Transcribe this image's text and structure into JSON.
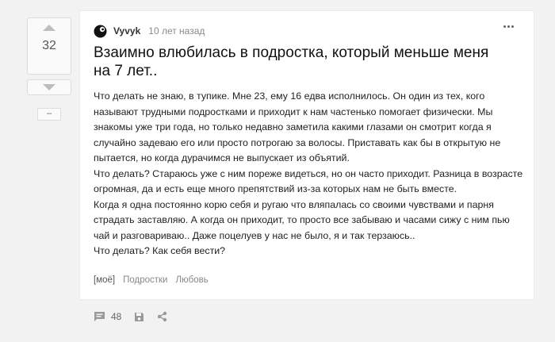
{
  "rating": {
    "count": "32",
    "minus_label": "–"
  },
  "post": {
    "author": "Vyvyk",
    "time": "10 лет назад",
    "title": "Взаимно влюбилась в подростка, который меньше меня на 7 лет..",
    "paragraphs": [
      "Что делать не знаю, в тупике. Мне 23, ему 16 едва исполнилось. Он один из тех, кого называют трудными подростками и приходит к нам частенько помогает физически. Мы знакомы уже три года, но только недавно заметила какими глазами он смотрит когда я случайно задеваю его или просто потрогаю за волосы. Приставать как бы в открытую не пытается, но когда дурачимся не выпускает из объятий.",
      "Что делать? Стараюсь уже с ним пореже видеться, но он часто приходит. Разница в возрасте огромная, да и есть еще много препятствий из-за которых нам не быть вместе.",
      "Когда я одна постоянно корю себя и ругаю что вляпалась со своими чувствами и парня страдать заставляю. А когда он приходит, то просто все забываю и часами сижу с ним пью чай и разговариваю.. Даже поцелуев у нас не было, я и так терзаюсь..",
      "Что делать? Как себя вести?"
    ],
    "tags": [
      "[моё]",
      "Подростки",
      "Любовь"
    ]
  },
  "actions": {
    "comments_count": "48"
  },
  "icons": {
    "upvote": "arrow-up-icon",
    "downvote": "arrow-down-icon",
    "avatar": "avatar-icon",
    "more": "more-dots-icon",
    "comments": "comment-icon",
    "save": "save-icon",
    "share": "share-icon"
  },
  "colors": {
    "icon_gray": "#9a9a9a",
    "card_bg": "#ffffff",
    "page_bg": "#f2f2f2"
  }
}
